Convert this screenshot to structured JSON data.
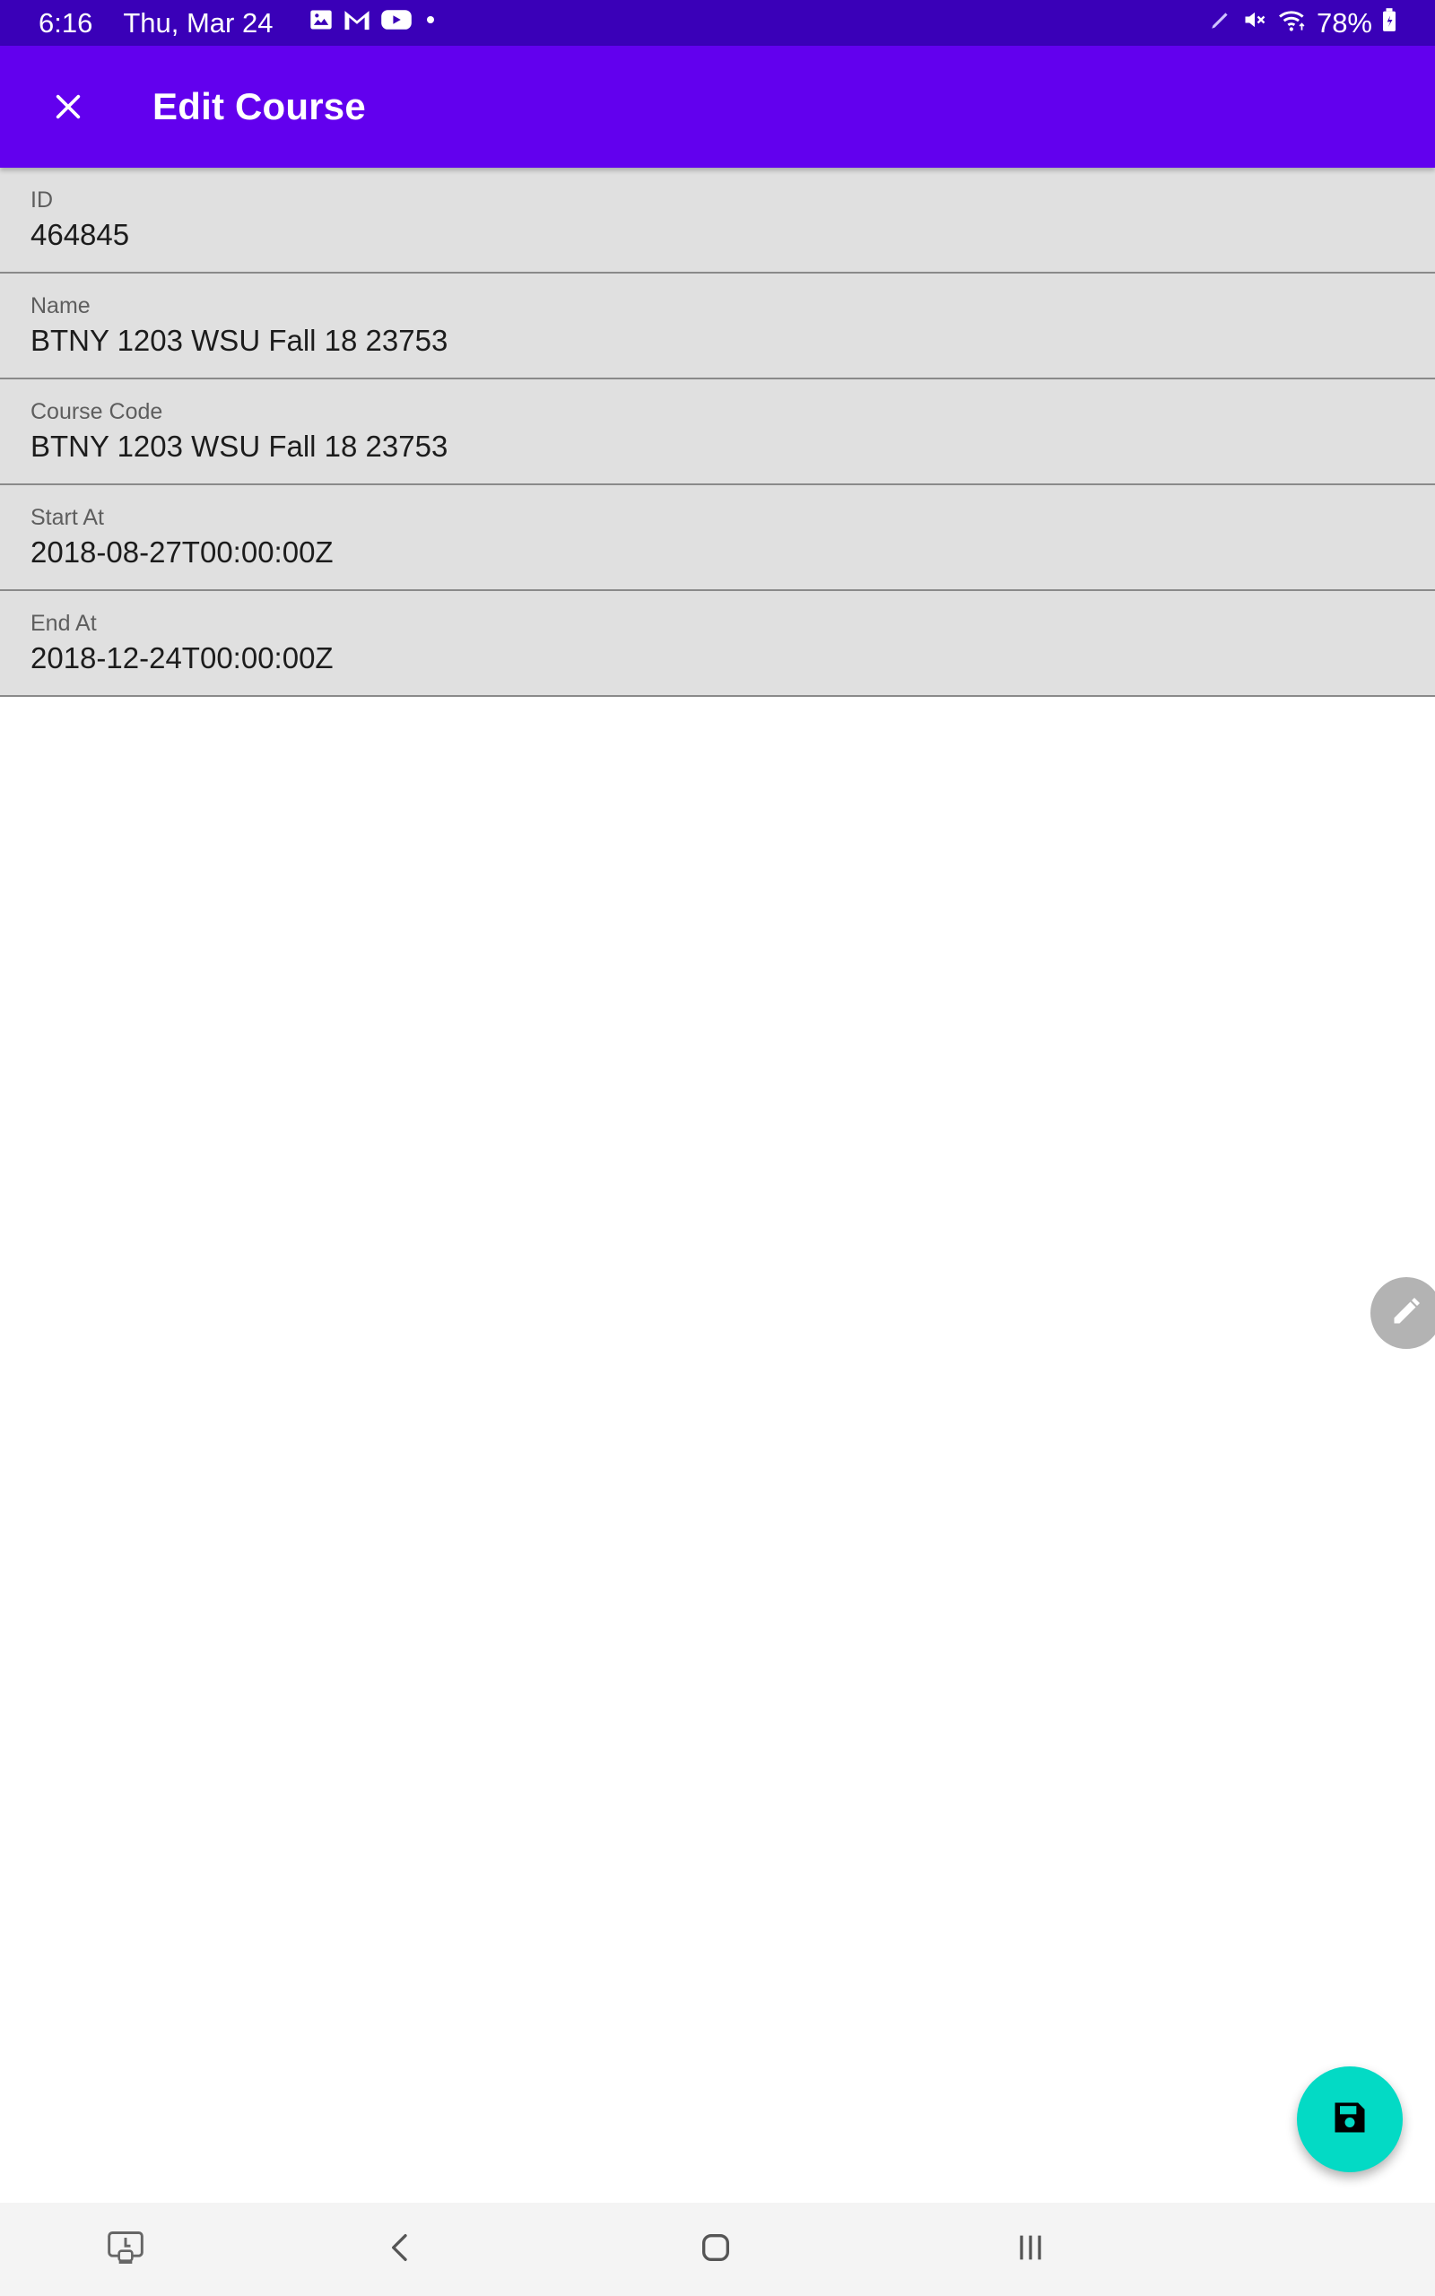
{
  "status_bar": {
    "time": "6:16",
    "date": "Thu, Mar 24",
    "battery": "78%",
    "icons_left": [
      "gallery-icon",
      "gmail-icon",
      "youtube-icon",
      "dot-icon"
    ],
    "icons_right": [
      "pen-icon",
      "mute-icon",
      "wifi-icon",
      "battery-icon"
    ]
  },
  "app_bar": {
    "title": "Edit Course",
    "close_icon": "close-icon"
  },
  "fields": [
    {
      "label": "ID",
      "value": "464845"
    },
    {
      "label": "Name",
      "value": "BTNY 1203 WSU Fall 18 23753"
    },
    {
      "label": "Course Code",
      "value": "BTNY 1203 WSU Fall 18 23753"
    },
    {
      "label": "Start At",
      "value": "2018-08-27T00:00:00Z"
    },
    {
      "label": "End At",
      "value": "2018-12-24T00:00:00Z"
    }
  ],
  "fab": {
    "icon": "save-icon"
  },
  "edge_handle": {
    "icon": "pencil-icon"
  },
  "nav_bar": {
    "buttons": [
      "screen-recorder-icon",
      "back-icon",
      "home-icon",
      "recents-icon"
    ]
  },
  "colors": {
    "status_bar": "#3a00b8",
    "app_bar": "#6200ee",
    "fab": "#03dac5",
    "field_bg": "#e0e0e0"
  }
}
